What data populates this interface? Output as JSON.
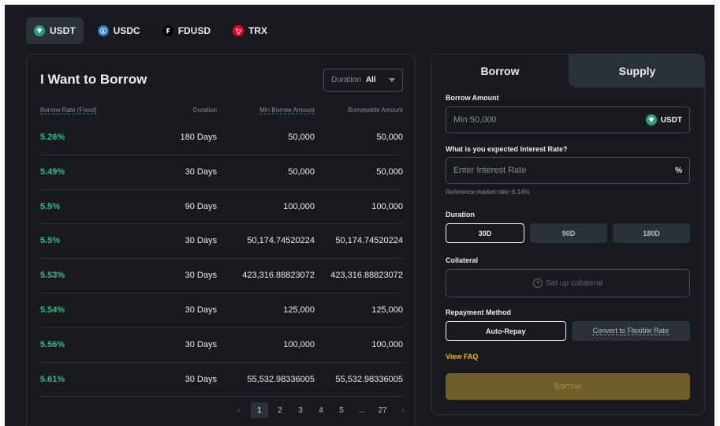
{
  "coins": [
    {
      "label": "USDT",
      "icon": "usdt-icon",
      "color": "#26a17b",
      "active": true
    },
    {
      "label": "USDC",
      "icon": "usdc-icon",
      "color": "#2775ca",
      "active": false
    },
    {
      "label": "FDUSD",
      "icon": "fdusd-icon",
      "color": "#000000",
      "active": false
    },
    {
      "label": "TRX",
      "icon": "trx-icon",
      "color": "#ef0027",
      "active": false
    }
  ],
  "borrow_list": {
    "title": "I Want to Borrow",
    "filter": {
      "label": "Duration",
      "value": "All"
    },
    "columns": {
      "rate": "Borrow Rate (Fixed)",
      "duration": "Duration",
      "min_amount": "Min Borrow Amount",
      "borrowable": "Borrowable Amount"
    },
    "rows": [
      {
        "rate": "5.26%",
        "duration": "180 Days",
        "min_amount": "50,000",
        "borrowable": "50,000"
      },
      {
        "rate": "5.49%",
        "duration": "30 Days",
        "min_amount": "50,000",
        "borrowable": "50,000"
      },
      {
        "rate": "5.5%",
        "duration": "90 Days",
        "min_amount": "100,000",
        "borrowable": "100,000"
      },
      {
        "rate": "5.5%",
        "duration": "30 Days",
        "min_amount": "50,174.74520224",
        "borrowable": "50,174.74520224"
      },
      {
        "rate": "5.53%",
        "duration": "30 Days",
        "min_amount": "423,316.88823072",
        "borrowable": "423,316.88823072"
      },
      {
        "rate": "5.54%",
        "duration": "30 Days",
        "min_amount": "125,000",
        "borrowable": "125,000"
      },
      {
        "rate": "5.56%",
        "duration": "30 Days",
        "min_amount": "100,000",
        "borrowable": "100,000"
      },
      {
        "rate": "5.61%",
        "duration": "30 Days",
        "min_amount": "55,532.98336005",
        "borrowable": "55,532.98336005"
      }
    ],
    "pagination": {
      "prev": "‹",
      "pages": [
        "1",
        "2",
        "3",
        "4",
        "5",
        "...",
        "27"
      ],
      "current": "1",
      "next": "›"
    }
  },
  "order_form": {
    "tabs": {
      "borrow": "Borrow",
      "supply": "Supply"
    },
    "active_tab": "Borrow",
    "amount": {
      "label": "Borrow Amount",
      "placeholder": "Min 50,000",
      "currency": "USDT"
    },
    "rate": {
      "label": "What is you expected Interest Rate?",
      "placeholder": "Enter Interest Rate",
      "suffix": "%",
      "hint": "Reference market rate: 6.14%"
    },
    "duration": {
      "label": "Duration",
      "options": [
        "30D",
        "90D",
        "180D"
      ],
      "selected": "30D"
    },
    "collateral": {
      "label": "Collateral",
      "button": "Set up collateral"
    },
    "repayment": {
      "label": "Repayment Method",
      "options": [
        "Auto-Repay",
        "Convert to Flexible Rate"
      ],
      "selected": "Auto-Repay"
    },
    "faq_link": "View FAQ",
    "submit": "Borrow"
  },
  "colors": {
    "background": "#181a20",
    "surface": "#2b3139",
    "positive": "#2ebd85",
    "accent": "#f0b90b",
    "button_disabled": "#6e5d29"
  }
}
